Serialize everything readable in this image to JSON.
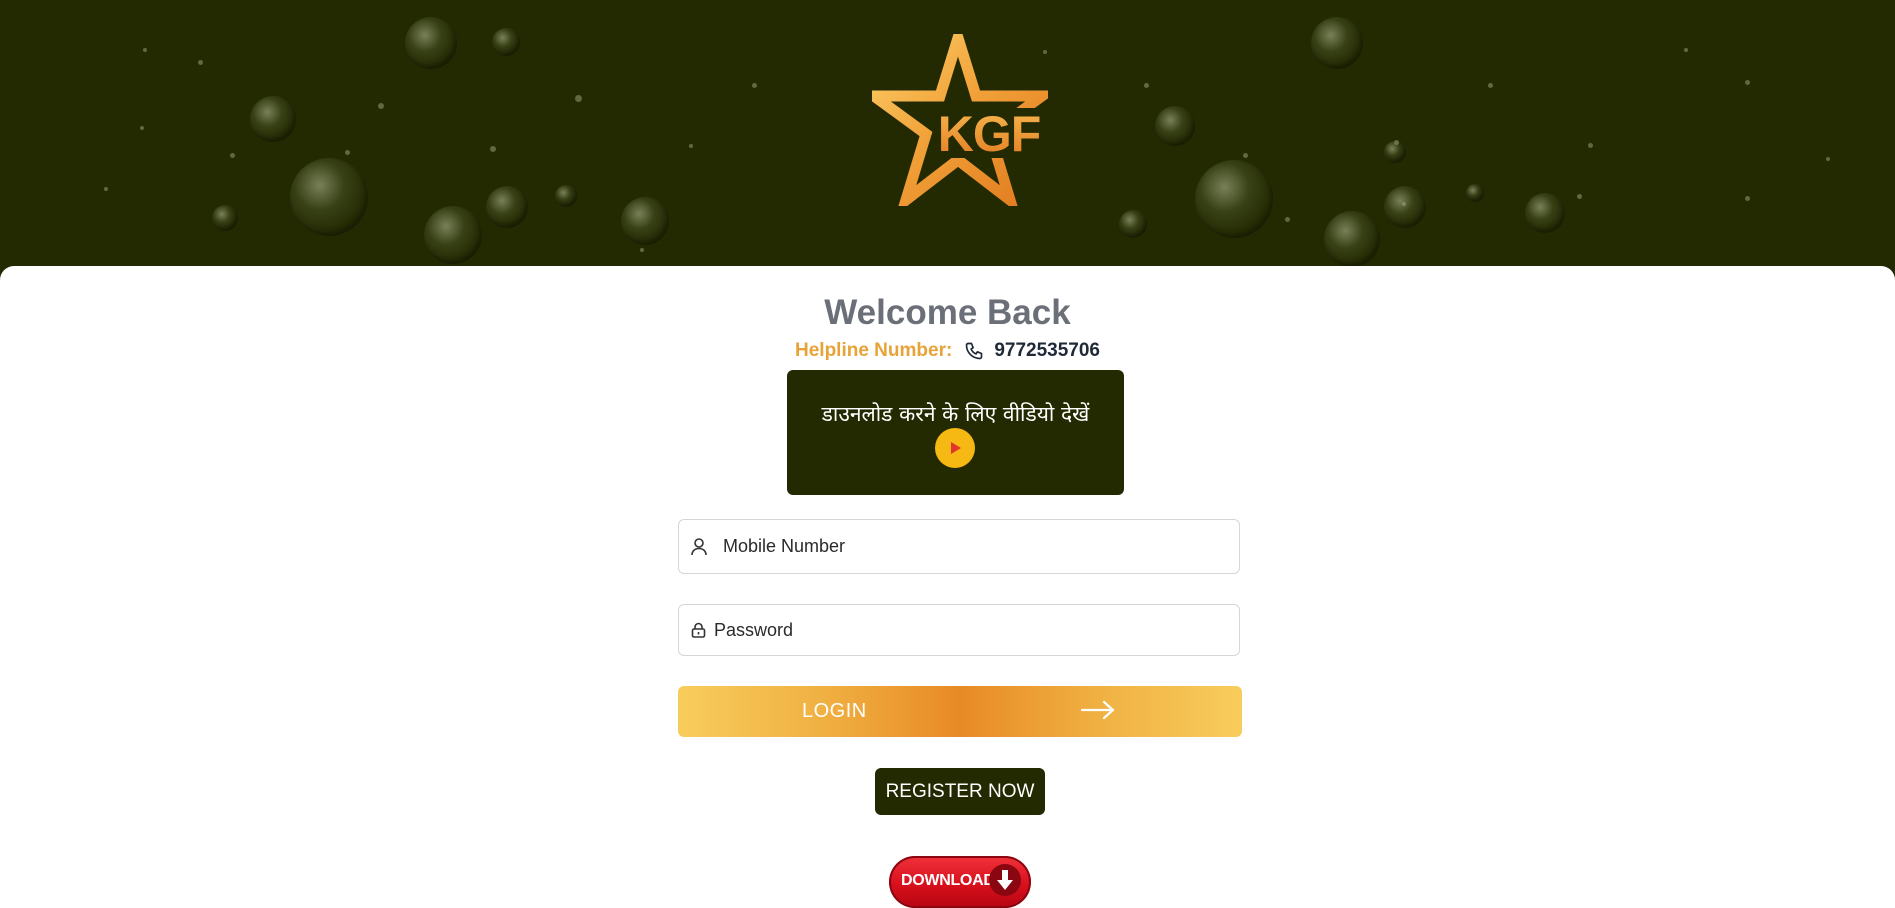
{
  "brand": {
    "logo_text": "KGF",
    "colors": {
      "dark_green": "#232a02",
      "gold": "#f6b812",
      "orange": "#e88a25",
      "red": "#d8101c"
    }
  },
  "header": {
    "title": "Welcome Back",
    "helpline_label": "Helpline Number:",
    "helpline_number": "9772535706",
    "helpline_icon": "phone-icon"
  },
  "video_card": {
    "text": "डाउनलोड करने के लिए वीडियो देखें",
    "icon": "play-icon"
  },
  "form": {
    "mobile_placeholder": "Mobile Number",
    "mobile_icon": "user-icon",
    "password_placeholder": "Password",
    "password_icon": "lock-icon",
    "login_label": "LOGIN",
    "login_icon": "arrow-right-icon"
  },
  "register_label": "REGISTER NOW",
  "download": {
    "label": "DOWNLOAD",
    "icon": "download-arrow-icon"
  }
}
